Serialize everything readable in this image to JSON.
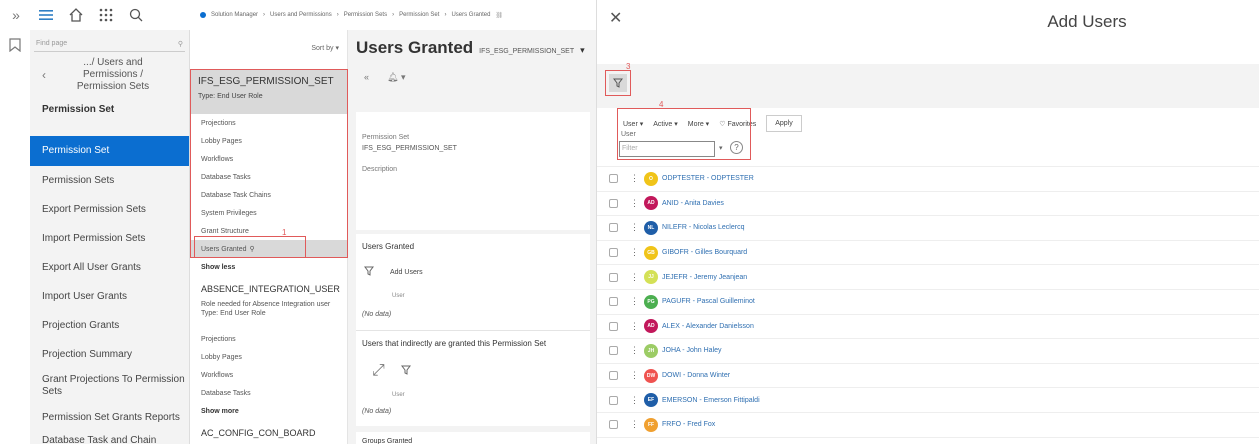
{
  "nav": {
    "find_placeholder": "Find page",
    "back_trail": ".../ Users and Permissions / Permission Sets",
    "heading": "Permission Set",
    "items": [
      {
        "label": "Permission Set",
        "active": true
      },
      {
        "label": "Permission Sets"
      },
      {
        "label": "Export Permission Sets"
      },
      {
        "label": "Import Permission Sets"
      },
      {
        "label": "Export All User Grants"
      },
      {
        "label": "Import User Grants"
      },
      {
        "label": "Projection Grants"
      },
      {
        "label": "Projection Summary"
      },
      {
        "label": "Grant Projections To Permission Sets"
      },
      {
        "label": "Permission Set Grants Reports"
      },
      {
        "label": "Database Task and Chain Grants"
      }
    ]
  },
  "breadcrumb": [
    "Solution Manager",
    "Users and Permissions",
    "Permission Sets",
    "Permission Set",
    "Users Granted"
  ],
  "list": {
    "sort_label": "Sort by",
    "selected": {
      "name": "IFS_ESG_PERMISSION_SET",
      "type": "Type:  End User Role"
    },
    "sub_items": [
      "Projections",
      "Lobby Pages",
      "Workflows",
      "Database Tasks",
      "Database Task Chains",
      "System Privileges",
      "Grant Structure",
      "Users Granted",
      "Show less"
    ],
    "second": {
      "name": "ABSENCE_INTEGRATION_USER",
      "desc": "Role needed for Absence Integration user",
      "type": "Type:  End User Role"
    },
    "second_items": [
      "Projections",
      "Lobby Pages",
      "Workflows",
      "Database Tasks",
      "Show more"
    ],
    "third_name": "AC_CONFIG_CON_BOARD"
  },
  "detail": {
    "title": "Users Granted",
    "subtitle": "IFS_ESG_PERMISSION_SET",
    "perm_label": "Permission Set",
    "perm_value": "IFS_ESG_PERMISSION_SET",
    "desc_label": "Description",
    "users_granted_header": "Users Granted",
    "add_users_label": "Add Users",
    "col_user": "User",
    "no_data": "(No data)",
    "indirect_header": "Users that indirectly are granted this Permission Set",
    "col_user2": "User",
    "no_data2": "(No data)",
    "groups_header": "Groups Granted"
  },
  "annotations": [
    "1",
    "2",
    "3",
    "4"
  ],
  "dialog": {
    "title": "Add Users",
    "filters": {
      "user": "User",
      "active": "Active",
      "more": "More",
      "favorites": "Favorites",
      "apply": "Apply"
    },
    "filter_field_label": "User",
    "filter_placeholder": "Filter",
    "users": [
      {
        "initials": "O",
        "label": "ODPTESTER - ODPTESTER",
        "color": "#f0c419"
      },
      {
        "initials": "AD",
        "label": "ANID - Anita Davies",
        "color": "#c2185b"
      },
      {
        "initials": "NL",
        "label": "NILEFR - Nicolas Leclercq",
        "color": "#1f5ea8"
      },
      {
        "initials": "GB",
        "label": "GIBOFR - Gilles Bourquard",
        "color": "#f0c419"
      },
      {
        "initials": "JJ",
        "label": "JEJEFR - Jeremy Jeanjean",
        "color": "#d4e157"
      },
      {
        "initials": "PG",
        "label": "PAGUFR - Pascal Guilleminot",
        "color": "#4caf50"
      },
      {
        "initials": "AD",
        "label": "ALEX - Alexander Danielsson",
        "color": "#c2185b"
      },
      {
        "initials": "JH",
        "label": "JOHA - John Haley",
        "color": "#9ccc65"
      },
      {
        "initials": "DW",
        "label": "DOWI - Donna Winter",
        "color": "#ef5350"
      },
      {
        "initials": "EF",
        "label": "EMERSON - Emerson Fittipaldi",
        "color": "#1f5ea8"
      },
      {
        "initials": "FF",
        "label": "FRFO - Fred Fox",
        "color": "#f0a030"
      }
    ]
  }
}
